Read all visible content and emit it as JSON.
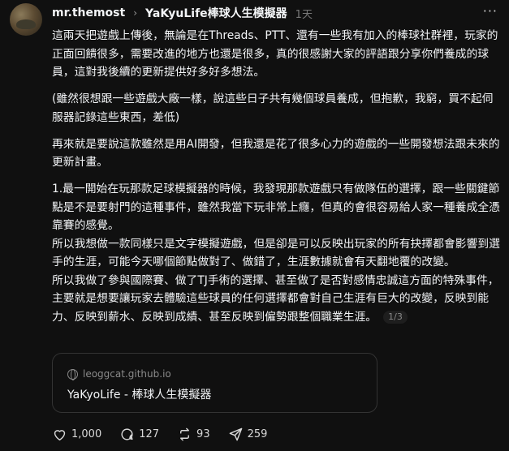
{
  "header": {
    "username": "mr.themost",
    "separator": "›",
    "game_title": "YaKyuLife棒球人生模擬器",
    "time": "1天",
    "more": "···"
  },
  "body": {
    "paragraphs": [
      "這兩天把遊戲上傳後，無論是在Threads、PTT、還有一些我有加入的棒球社群裡，玩家的正面回饋很多，需要改進的地方也還是很多，真的很感謝大家的評語跟分享你們養成的球員，這對我後續的更新提供好多好多想法。",
      "(雖然很想跟一些遊戲大廠一樣，說這些日子共有幾個球員養成，但抱歉，我窮，買不起伺服器記錄這些東西，差低)",
      "再來就是要說這款雖然是用AI開發，但我還是花了很多心力的遊戲的一些開發想法跟未來的更新計畫。",
      "1.最一開始在玩那款足球模擬器的時候，我發現那款遊戲只有做隊伍的選擇，跟一些關鍵節點是不是要射門的這種事件，雖然我當下玩非常上癮，但真的會很容易給人家一種養成全憑靠賽的感覺。",
      "所以我想做一款同樣只是文字模擬遊戲，但是卻是可以反映出玩家的所有抉擇都會影響到選手的生涯，可能今天哪個節點做對了、做錯了，生涯數據就會有天翻地覆的改變。",
      "所以我做了參與國際賽、做了TJ手術的選擇、甚至做了是否對感情忠誠這方面的特殊事件，主要就是想要讓玩家去體驗這些球員的任何選擇都會對自己生涯有巨大的改變，反映到能力、反映到薪水、反映到成績、甚至反映到僱勢跟整個職業生涯。"
    ],
    "page_indicator": "1/3"
  },
  "link_card": {
    "domain": "leoggcat.github.io",
    "title": "YaKyoLife - 棒球人生模擬器",
    "icon": "globe-icon"
  },
  "actions": {
    "like_count": "1,000",
    "comment_count": "127",
    "repost_count": "93",
    "share_count": "259"
  },
  "colors": {
    "background": "#101010",
    "text": "#f3f5f7",
    "muted": "#777777",
    "border": "#333333"
  }
}
